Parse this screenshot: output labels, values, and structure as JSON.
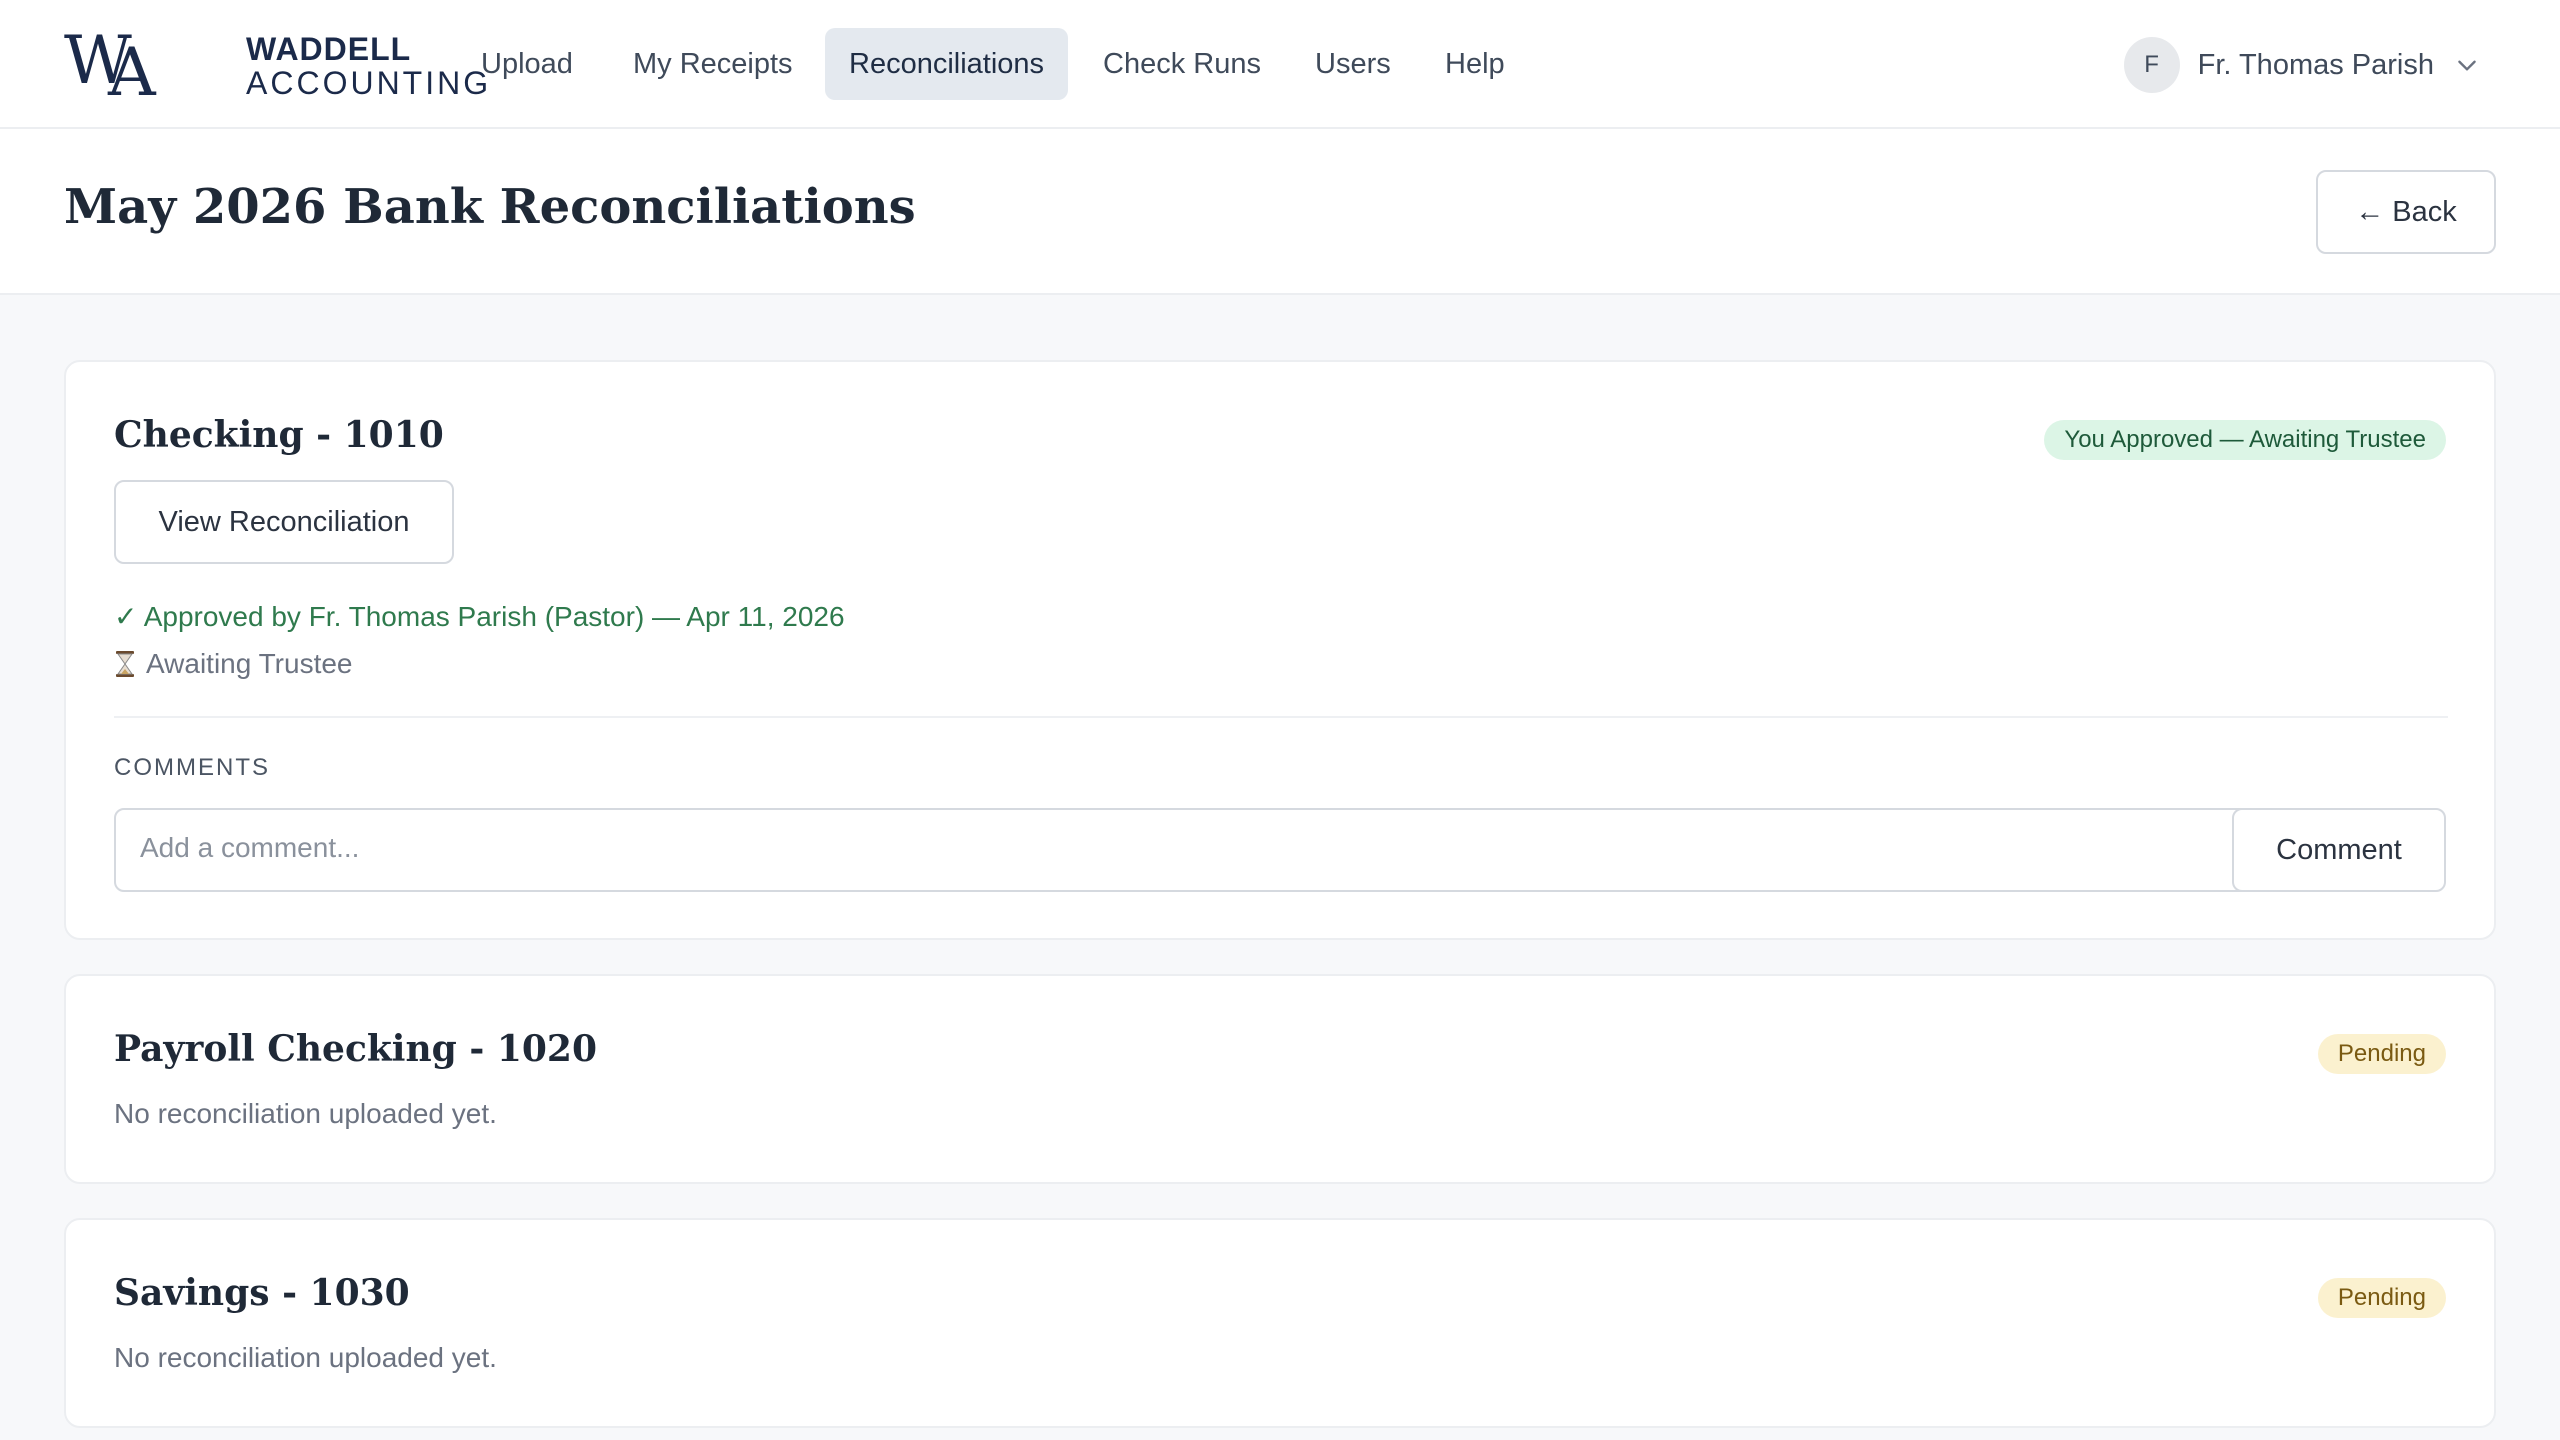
{
  "brand": {
    "line1": "WADDELL",
    "line2": "ACCOUNTING",
    "mark": "WA"
  },
  "nav": [
    {
      "label": "Upload",
      "active": false
    },
    {
      "label": "My Receipts",
      "active": false
    },
    {
      "label": "Reconciliations",
      "active": true
    },
    {
      "label": "Check Runs",
      "active": false
    },
    {
      "label": "Users",
      "active": false
    },
    {
      "label": "Help",
      "active": false
    }
  ],
  "user": {
    "initial": "F",
    "name": "Fr. Thomas Parish",
    "menu_icon": "chevron-down-icon"
  },
  "page": {
    "title": "May 2026 Bank Reconciliations",
    "back_label": "← Back"
  },
  "accounts": [
    {
      "title": "Checking - 1010",
      "status": "You Approved — Awaiting Trustee",
      "status_color": "#dcf5e6",
      "view_label": "View Reconciliation",
      "approval": "✓ Approved by Fr. Thomas Parish (Pastor) — Apr 11, 2026",
      "awaiting": "Awaiting Trustee",
      "awaiting_icon": "hourglass-icon",
      "comments_label": "COMMENTS",
      "comment_placeholder": "Add a comment...",
      "comment_button": "Comment"
    },
    {
      "title": "Payroll Checking - 1020",
      "status": "Pending",
      "status_color": "#fbf1cf",
      "empty": "No reconciliation uploaded yet."
    },
    {
      "title": "Savings - 1030",
      "status": "Pending",
      "status_color": "#fbf1cf",
      "empty": "No reconciliation uploaded yet."
    }
  ]
}
